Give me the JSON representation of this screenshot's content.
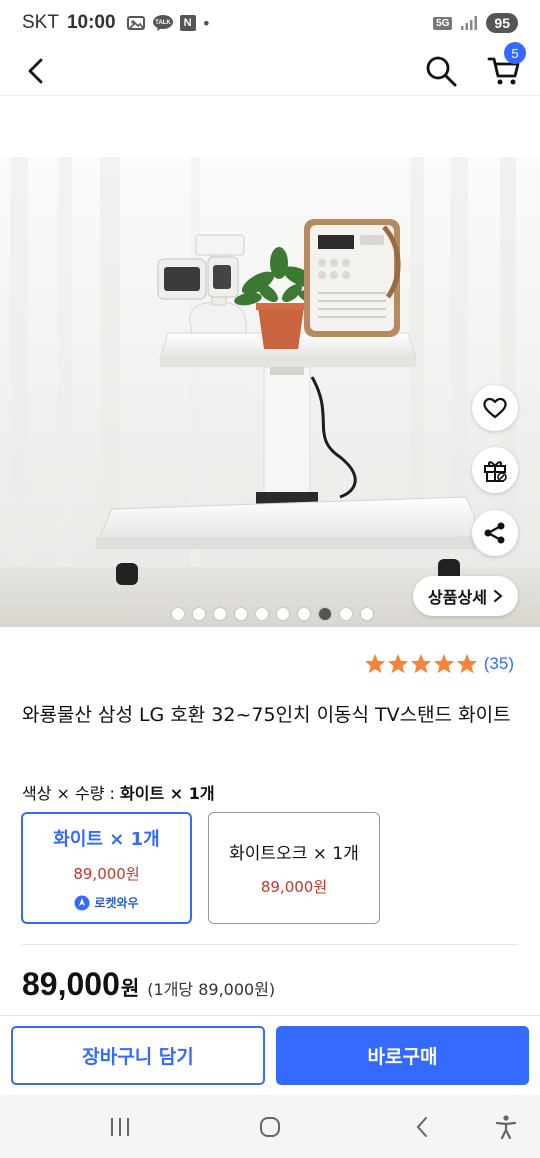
{
  "status_bar": {
    "carrier": "SKT",
    "time": "10:00",
    "icons": [
      "image-icon",
      "talk-icon",
      "naver-icon",
      "dot"
    ],
    "talk_label": "TALK",
    "naver_label": "N",
    "network": "5G",
    "battery": "95"
  },
  "header": {
    "cart_count": "5"
  },
  "gallery": {
    "slide_count": 10,
    "active_index": 7,
    "detail_button": "상품상세",
    "actions": [
      "heart-icon",
      "gift-icon",
      "share-icon"
    ]
  },
  "rating": {
    "stars": 5,
    "count": "(35)"
  },
  "product": {
    "title": "와룡물산 삼성 LG 호환 32~75인치 이동식 TV스탠드 화이트"
  },
  "option": {
    "label_prefix": "색상 × 수량 : ",
    "label_selected": "화이트 × 1개",
    "items": [
      {
        "name": "화이트 × 1개",
        "price": "89,000원",
        "badge": "로켓와우"
      },
      {
        "name": "화이트오크 × 1개",
        "price": "89,000원"
      }
    ]
  },
  "price": {
    "amount": "89,000",
    "won": "원",
    "per_unit": "(1개당 89,000원)"
  },
  "actions": {
    "add_to_cart": "장바구니 담기",
    "buy_now": "바로구매"
  },
  "colors": {
    "accent": "#346aff",
    "price_red": "#c0392b",
    "star": "#f5843b"
  }
}
